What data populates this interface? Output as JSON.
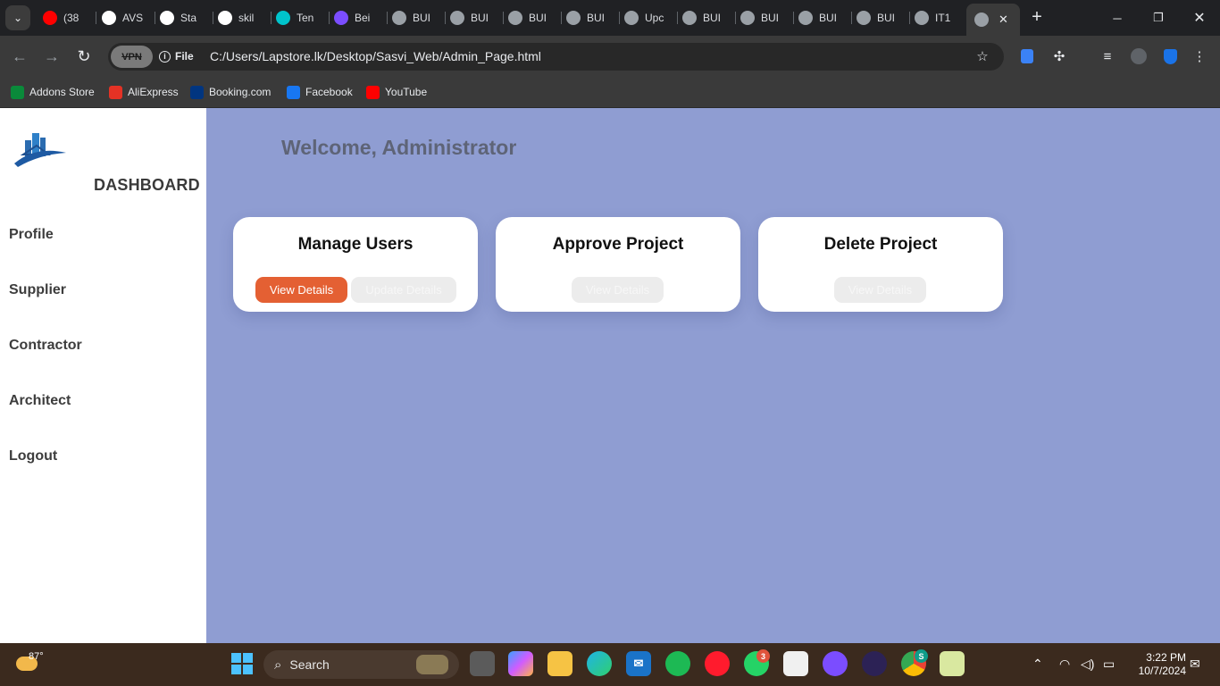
{
  "browser": {
    "tabs": [
      {
        "label": "(38",
        "icon": "youtube-icon",
        "color": "#ff0000"
      },
      {
        "label": "AVS",
        "icon": "github-icon",
        "color": "#ffffff"
      },
      {
        "label": "Sta",
        "icon": "search-doc-icon",
        "color": "#ffffff"
      },
      {
        "label": "skil",
        "icon": "github-icon",
        "color": "#ffffff"
      },
      {
        "label": "Ten",
        "icon": "canva-icon",
        "color": "#00c4cc"
      },
      {
        "label": "Bei",
        "icon": "heart-icon",
        "color": "#7b4dff"
      },
      {
        "label": "BUI",
        "icon": "globe-icon",
        "color": "#9aa0a6"
      },
      {
        "label": "BUI",
        "icon": "globe-icon",
        "color": "#9aa0a6"
      },
      {
        "label": "BUI",
        "icon": "globe-icon",
        "color": "#9aa0a6"
      },
      {
        "label": "BUI",
        "icon": "globe-icon",
        "color": "#9aa0a6"
      },
      {
        "label": "Upc",
        "icon": "globe-icon",
        "color": "#9aa0a6"
      },
      {
        "label": "BUI",
        "icon": "globe-icon",
        "color": "#9aa0a6"
      },
      {
        "label": "BUI",
        "icon": "globe-icon",
        "color": "#9aa0a6"
      },
      {
        "label": "BUI",
        "icon": "globe-icon",
        "color": "#9aa0a6"
      },
      {
        "label": "BUI",
        "icon": "globe-icon",
        "color": "#9aa0a6"
      },
      {
        "label": "IT1",
        "icon": "globe-icon",
        "color": "#9aa0a6"
      }
    ],
    "vpn_label": "VPN",
    "file_label": "File",
    "url": "C:/Users/Lapstore.lk/Desktop/Sasvi_Web/Admin_Page.html",
    "bookmarks": [
      {
        "label": "Addons Store",
        "icon": "addons-store-icon",
        "color": "#0a8a3a"
      },
      {
        "label": "AliExpress",
        "icon": "aliexpress-icon",
        "color": "#e43225"
      },
      {
        "label": "Booking.com",
        "icon": "booking-icon",
        "color": "#003580"
      },
      {
        "label": "Facebook",
        "icon": "facebook-icon",
        "color": "#1877f2"
      },
      {
        "label": "YouTube",
        "icon": "youtube-icon",
        "color": "#ff0000"
      }
    ]
  },
  "sidebar": {
    "title": "DASHBOARD",
    "items": [
      {
        "label": "Profile"
      },
      {
        "label": "Supplier"
      },
      {
        "label": "Contractor"
      },
      {
        "label": "Architect"
      },
      {
        "label": "Logout"
      }
    ]
  },
  "main": {
    "welcome": "Welcome, Administrator",
    "cards": [
      {
        "title": "Manage Users",
        "buttons": [
          {
            "label": "View Details",
            "style": "primary"
          },
          {
            "label": "Update Details",
            "style": "muted"
          }
        ]
      },
      {
        "title": "Approve Project",
        "buttons": [
          {
            "label": "View Details",
            "style": "muted"
          }
        ]
      },
      {
        "title": "Delete Project",
        "buttons": [
          {
            "label": "View Details",
            "style": "muted"
          }
        ]
      }
    ]
  },
  "taskbar": {
    "weather_temp": "87°",
    "search_placeholder": "Search",
    "whatsapp_badge": "3",
    "chrome_profile_badge": "S",
    "time": "3:22 PM",
    "date": "10/7/2024"
  },
  "colors": {
    "page_bg": "#8f9dd2",
    "accent": "#e46033",
    "sidebar_bg": "#ffffff"
  }
}
